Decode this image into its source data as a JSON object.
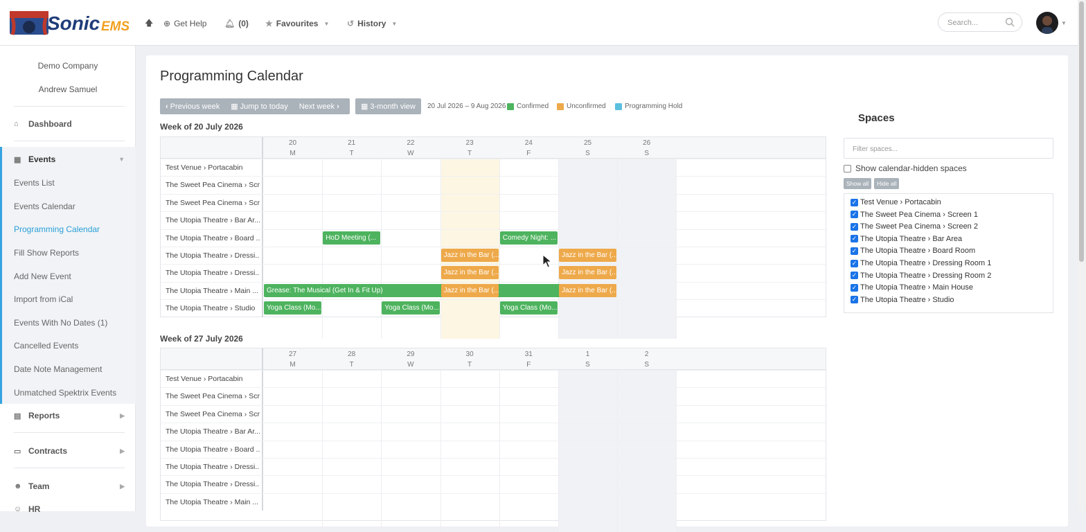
{
  "brand": {
    "name": "Sonic",
    "suffix": "EMS"
  },
  "topbar": {
    "help_label": "Get Help",
    "notifications_label": "(0)",
    "favourites_label": "Favourites",
    "history_label": "History",
    "search_placeholder": "Search..."
  },
  "sidebar": {
    "company": "Demo Company",
    "user": "Andrew Samuel",
    "dashboard": "Dashboard",
    "events": "Events",
    "event_items": [
      "Events List",
      "Events Calendar",
      "Programming Calendar",
      "Fill Show Reports",
      "Add New Event",
      "Import from iCal",
      "Events With No Dates (1)",
      "Cancelled Events",
      "Date Note Management",
      "Unmatched Spektrix Events"
    ],
    "active_item": "Programming Calendar",
    "reports": "Reports",
    "contracts": "Contracts",
    "team": "Team",
    "hr": "HR"
  },
  "page": {
    "title": "Programming Calendar",
    "prev_week": "Previous week",
    "jump_today": "Jump to today",
    "next_week": "Next week",
    "three_month": "3-month view",
    "range": "20 Jul 2026 – 9 Aug 2026",
    "legend": [
      {
        "label": "Confirmed",
        "color": "#4db35e"
      },
      {
        "label": "Unconfirmed",
        "color": "#eea94a"
      },
      {
        "label": "Programming Hold",
        "color": "#5bc0de"
      }
    ]
  },
  "weeks": [
    {
      "title": "Week of 20 July 2026",
      "dates": [
        "20",
        "21",
        "22",
        "23",
        "24",
        "25",
        "26"
      ],
      "days": [
        "M",
        "T",
        "W",
        "T",
        "F",
        "S",
        "S"
      ],
      "rows": [
        "Test Venue › Portacabin",
        "The Sweet Pea Cinema › Scr...",
        "The Sweet Pea Cinema › Scr...",
        "The Utopia Theatre › Bar Ar...",
        "The Utopia Theatre › Board ...",
        "The Utopia Theatre › Dressi...",
        "The Utopia Theatre › Dressi...",
        "The Utopia Theatre › Main ...",
        "The Utopia Theatre › Studio"
      ],
      "events": [
        {
          "row": 4,
          "day": 1,
          "span": 1,
          "label": "HoD Meeting (...",
          "status": "confirmed"
        },
        {
          "row": 4,
          "day": 4,
          "span": 1,
          "label": "Comedy Night: ...",
          "status": "confirmed"
        },
        {
          "row": 5,
          "day": 3,
          "span": 1,
          "label": "Jazz in the Bar (...",
          "status": "unconfirmed"
        },
        {
          "row": 5,
          "day": 5,
          "span": 1,
          "label": "Jazz in the Bar (...",
          "status": "unconfirmed"
        },
        {
          "row": 6,
          "day": 3,
          "span": 1,
          "label": "Jazz in the Bar (...",
          "status": "unconfirmed"
        },
        {
          "row": 6,
          "day": 5,
          "span": 1,
          "label": "Jazz in the Bar (...",
          "status": "unconfirmed"
        },
        {
          "row": 7,
          "day": 0,
          "span": 6,
          "label": "Grease: The Musical (Get In & Fit Up)",
          "status": "confirmed"
        },
        {
          "row": 7,
          "day": 3,
          "span": 1,
          "label": "Jazz in the Bar (...",
          "status": "unconfirmed"
        },
        {
          "row": 7,
          "day": 5,
          "span": 1,
          "label": "Jazz in the Bar (...",
          "status": "unconfirmed"
        },
        {
          "row": 8,
          "day": 0,
          "span": 1,
          "label": "Yoga Class (Mo...",
          "status": "confirmed"
        },
        {
          "row": 8,
          "day": 2,
          "span": 1,
          "label": "Yoga Class (Mo...",
          "status": "confirmed"
        },
        {
          "row": 8,
          "day": 4,
          "span": 1,
          "label": "Yoga Class (Mo...",
          "status": "confirmed"
        }
      ],
      "today_index": 3
    },
    {
      "title": "Week of 27 July 2026",
      "dates": [
        "27",
        "28",
        "29",
        "30",
        "31",
        "1",
        "2"
      ],
      "days": [
        "M",
        "T",
        "W",
        "T",
        "F",
        "S",
        "S"
      ],
      "rows": [
        "Test Venue › Portacabin",
        "The Sweet Pea Cinema › Scr...",
        "The Sweet Pea Cinema › Scr...",
        "The Utopia Theatre › Bar Ar...",
        "The Utopia Theatre › Board ...",
        "The Utopia Theatre › Dressi...",
        "The Utopia Theatre › Dressi...",
        "The Utopia Theatre › Main ..."
      ],
      "events": [],
      "today_index": -1
    }
  ],
  "spaces": {
    "title": "Spaces",
    "filter_placeholder": "Filter spaces...",
    "show_hidden": "Show calendar-hidden spaces",
    "show_all": "Show all",
    "hide_all": "Hide all",
    "items": [
      "Test Venue › Portacabin",
      "The Sweet Pea Cinema › Screen 1",
      "The Sweet Pea Cinema › Screen 2",
      "The Utopia Theatre › Bar Area",
      "The Utopia Theatre › Board Room",
      "The Utopia Theatre › Dressing Room 1",
      "The Utopia Theatre › Dressing Room 2",
      "The Utopia Theatre › Main House",
      "The Utopia Theatre › Studio"
    ]
  }
}
